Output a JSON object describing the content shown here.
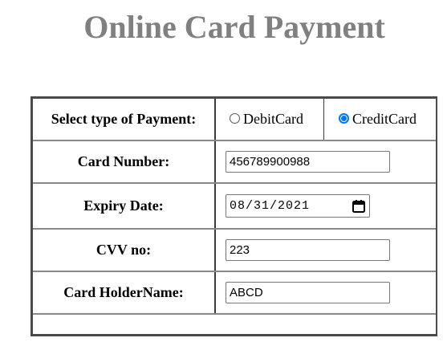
{
  "page": {
    "title": "Online Card Payment"
  },
  "payment_type": {
    "label": "Select type of Payment:",
    "options": [
      {
        "label": "DebitCard",
        "checked": false
      },
      {
        "label": "CreditCard",
        "checked": true
      }
    ]
  },
  "card_number": {
    "label": "Card Number:",
    "value": "456789900988"
  },
  "expiry_date": {
    "label": "Expiry Date:",
    "value": "08/31/2021",
    "icon": "calendar-icon"
  },
  "cvv": {
    "label": "CVV no:",
    "value": "223"
  },
  "card_holder": {
    "label": "Card HolderName:",
    "value": "ABCD"
  },
  "colors": {
    "title": "#808080",
    "radio_accent": "#0075ff",
    "table_border": "#4a4a4a"
  }
}
